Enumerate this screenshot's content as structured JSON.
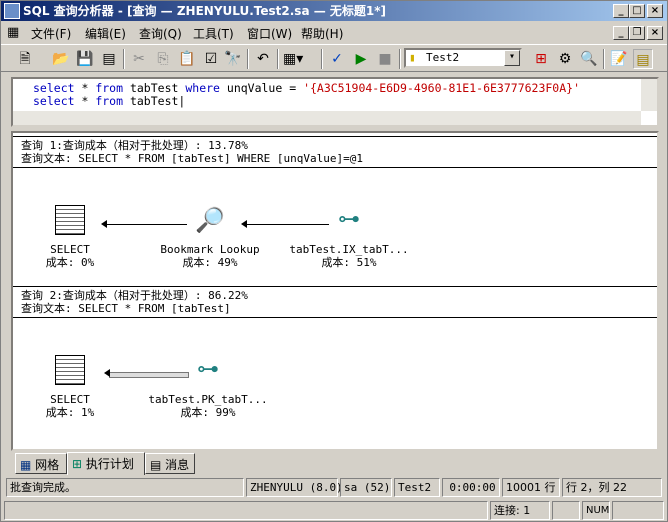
{
  "window": {
    "title": "SQL 查询分析器 - [查询 — ZHENYULU.Test2.sa — 无标题1*]"
  },
  "menu": [
    "文件(F)",
    "编辑(E)",
    "查询(Q)",
    "工具(T)",
    "窗口(W)",
    "帮助(H)"
  ],
  "toolbar": {
    "database": "Test2"
  },
  "editor": {
    "line1": {
      "k1": "select",
      "t1": " * ",
      "k2": "from",
      "t2": " tabTest ",
      "k3": "where",
      "t3": " unqValue = ",
      "s": "'{A3C51904-E6D9-4960-81E1-6E3777623F0A}'"
    },
    "line2": {
      "k1": "select",
      "t1": " * ",
      "k2": "from",
      "t2": " tabTest"
    }
  },
  "plan": {
    "q1": {
      "cost": "查询 1:查询成本（相对于批处理）: 13.78%",
      "text": "查询文本: SELECT * FROM [tabTest] WHERE [unqValue]=@1",
      "nodes": [
        {
          "name": "SELECT",
          "cost": "成本: 0%"
        },
        {
          "name": "Bookmark Lookup",
          "cost": "成本: 49%"
        },
        {
          "name": "tabTest.IX_tabT...",
          "cost": "成本: 51%"
        }
      ]
    },
    "q2": {
      "cost": "查询 2:查询成本（相对于批处理）: 86.22%",
      "text": "查询文本: SELECT * FROM [tabTest]",
      "nodes": [
        {
          "name": "SELECT",
          "cost": "成本: 1%"
        },
        {
          "name": "tabTest.PK_tabT...",
          "cost": "成本: 99%"
        }
      ]
    }
  },
  "tabs": [
    "网格",
    "执行计划",
    "消息"
  ],
  "status": {
    "msg": "批查询完成。",
    "server": "ZHENYULU (8.0)",
    "user": "sa (52)",
    "db": "Test2",
    "time": "0:00:00",
    "rows": "10001 行",
    "pos": "行 2，列 22",
    "conn": "连接: 1",
    "num": "NUM"
  }
}
